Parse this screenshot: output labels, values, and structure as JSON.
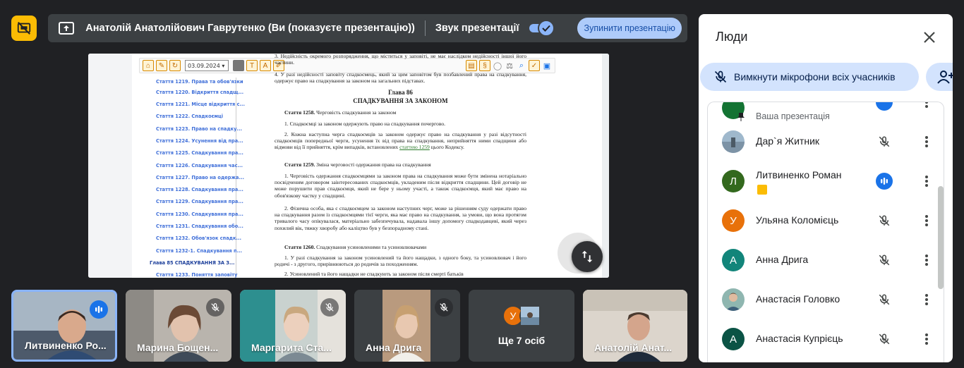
{
  "topbar": {
    "presenter_text": "Анатолій Анатолійович Гаврутенко (Ви (показуєте презентацію))",
    "audio_label": "Звук презентації",
    "audio_enabled": true,
    "stop_button": "Зупинити презентацію"
  },
  "shared_screen": {
    "date_value": "03.09.2024",
    "toc": [
      "Стаття 1219. Права та обов'язки",
      "Стаття 1220. Відкриття спадщ...",
      "Стаття 1221. Місце відкриття с...",
      "Стаття 1222. Спадкоємці",
      "Стаття 1223. Право на спадку...",
      "Стаття 1224. Усунення від пра...",
      "Стаття 1225. Спадкування пра...",
      "Стаття 1226. Спадкування час...",
      "Стаття 1227. Право на одержа...",
      "Стаття 1228. Спадкування пра...",
      "Стаття 1229. Спадкування пра...",
      "Стаття 1230. Спадкування пра...",
      "Стаття 1231. Спадкування обо...",
      "Стаття 1232. Обов'язок спадк...",
      "Стаття 1232-1. Спадкування п...",
      "Глава 85 СПАДКУВАННЯ ЗА З...",
      "Стаття 1233. Поняття заповіту"
    ],
    "doc": {
      "p_top": "3. Недійсність окремого розпорядження, що міститься у заповіті, не має наслідком недійсності іншої його частини.",
      "p_4": "4. У разі недійсності заповіту спадкоємець, який за цим заповітом був позбавлений права на спадкування, одержує право на спадкування за законом на загальних підставах.",
      "chapter": "Глава 86",
      "chapter_title": "СПАДКУВАННЯ ЗА ЗАКОНОМ",
      "a1258_num": "Стаття 1258.",
      "a1258_title": "Черговість спадкування за законом",
      "a1258_p1": "1. Спадкоємці за законом одержують право на спадкування почергово.",
      "a1258_p2": "2. Кожна наступна черга спадкоємців за законом одержує право на спадкування у разі відсутності спадкоємців попередньої черги, усунення їх від права на спадкування, неприйняття ними спадщини або відмови від її прийняття, крім випадків, встановлених",
      "a1258_link": "статтею 1259",
      "a1258_tail": "цього Кодексу.",
      "a1259_num": "Стаття 1259.",
      "a1259_title": "Зміна черговості одержання права на спадкування",
      "a1259_p1": "1. Черговість одержання спадкоємцями за законом права на спадкування може бути змінена нотаріально посвідченим договором заінтересованих спадкоємців, укладеним після відкриття спадщини. Цей договір не може порушити прав спадкоємця, який не бере у ньому участі, а також спадкоємця, який має право на обов'язкову частку у спадщині.",
      "a1259_p2": "2. Фізична особа, яка є спадкоємцем за законом наступних черг, може за рішенням суду одержати право на спадкування разом із спадкоємцями тієї черги, яка має право на спадкування, за умови, що вона протягом тривалого часу опікувалася, матеріально забезпечувала, надавала іншу допомогу спадкодавцеві, який через похилий вік, тяжку хворобу або каліцтво був у безпорадному стані.",
      "a1260_num": "Стаття 1260.",
      "a1260_title": "Спадкування усиновленими та усиновлювачами",
      "a1260_p1": "1. У разі спадкування за законом усиновлений та його нащадки, з одного боку, та усиновлювач і його родичі - з другого, прирівнюються до родичів за походженням.",
      "a1260_p2": "2. Усиновлений та його нащадки не спадкують за законом після смерті батьків"
    }
  },
  "tiles": [
    {
      "name": "Литвиненко Ро...",
      "state": "speaking"
    },
    {
      "name": "Марина Бощен...",
      "state": "muted"
    },
    {
      "name": "Маргарита Ста...",
      "state": "muted"
    },
    {
      "name": "Анна Дрига",
      "state": "muted"
    },
    {
      "name": "Ще 7 осіб",
      "avatar_letter": "У"
    },
    {
      "name": "Анатолій Анат..."
    }
  ],
  "people_panel": {
    "title": "Люди",
    "mute_all": "Вимкнути мікрофони всіх учасників",
    "participants": [
      {
        "name": "",
        "sub": "Ваша презентація"
      },
      {
        "name": "Дар`я Житник",
        "mic": "muted"
      },
      {
        "name": "Литвиненко Роман",
        "letter": "Л",
        "mic": "speaking",
        "presenting": true
      },
      {
        "name": "Ульяна Коломієць",
        "letter": "У",
        "mic": "muted"
      },
      {
        "name": "Анна Дрига",
        "letter": "А",
        "mic": "muted"
      },
      {
        "name": "Анастасія Головко",
        "mic": "muted"
      },
      {
        "name": "Анастасія Купрієць",
        "letter": "А",
        "mic": "muted"
      }
    ]
  },
  "colors": {
    "background": "#202124",
    "accent_blue": "#8ab4f8",
    "sharing_yellow": "#fbbc04",
    "panel": "#ffffff",
    "speaking_blue": "#1a73e8"
  },
  "icons": [
    "stop-sharing-icon",
    "present-screen-icon",
    "checkmark-icon",
    "close-icon",
    "mic-off-icon",
    "add-person-icon",
    "more-vert-icon",
    "audio-bars-icon",
    "scroll-toggle-icon",
    "pin-icon"
  ]
}
